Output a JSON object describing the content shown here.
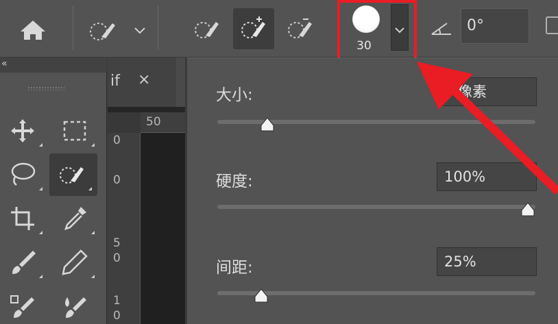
{
  "options_bar": {
    "brush_size": "30",
    "angle_value": "0°"
  },
  "toolbox": {
    "collapse_glyph": "«"
  },
  "document": {
    "tab_name": "if",
    "tab_close": "×",
    "ruler_top_label": "50",
    "ruler_left_labels": [
      "0",
      "0",
      "5\n0",
      "1\n0"
    ]
  },
  "brush_popup": {
    "size_label": "大小:",
    "size_value": "0 像素",
    "size_fraction": 0.14,
    "hardness_label": "硬度:",
    "hardness_value": "100%",
    "hardness_fraction": 1.0,
    "spacing_label": "间距:",
    "spacing_value": "25%",
    "spacing_fraction": 0.12
  },
  "colors": {
    "highlight": "#ea1c24",
    "panel": "#535353"
  },
  "icons": [
    "home-icon",
    "quick-selection-icon",
    "new-selection-icon",
    "add-to-selection-icon",
    "subtract-from-selection-icon",
    "chevron-down-icon",
    "angle-icon",
    "move-icon",
    "marquee-icon",
    "lasso-icon",
    "crop-icon",
    "eyedropper-icon",
    "brush-icon",
    "pencil-icon",
    "stamp-icon",
    "history-brush-icon"
  ]
}
